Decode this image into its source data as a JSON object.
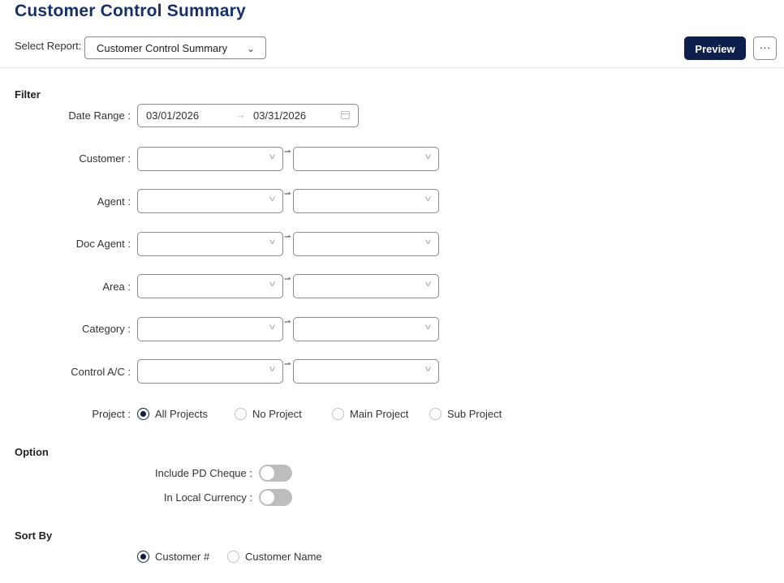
{
  "page": {
    "title": "Customer Control Summary"
  },
  "toolbar": {
    "select_report_label": "Select Report:",
    "selected_report": "Customer Control Summary",
    "preview_label": "Preview",
    "more_label": "···"
  },
  "filter": {
    "heading": "Filter",
    "date_range": {
      "label": "Date Range :",
      "from": "03/01/2026",
      "to": "03/31/2026"
    },
    "range_fields": [
      {
        "label": "Customer :",
        "from_value": "",
        "to_value": ""
      },
      {
        "label": "Agent :",
        "from_value": "",
        "to_value": ""
      },
      {
        "label": "Doc Agent :",
        "from_value": "",
        "to_value": ""
      },
      {
        "label": "Area :",
        "from_value": "",
        "to_value": ""
      },
      {
        "label": "Category :",
        "from_value": "",
        "to_value": ""
      },
      {
        "label": "Control A/C :",
        "from_value": "",
        "to_value": ""
      }
    ],
    "project": {
      "label": "Project :",
      "options": [
        "All Projects",
        "No Project",
        "Main Project",
        "Sub Project"
      ],
      "selected": "All Projects"
    }
  },
  "option": {
    "heading": "Option",
    "toggles": [
      {
        "label": "Include PD Cheque :",
        "on": false
      },
      {
        "label": "In Local Currency :",
        "on": false
      }
    ]
  },
  "sort_by": {
    "heading": "Sort By",
    "options": [
      "Customer #",
      "Customer Name"
    ],
    "selected": "Customer #"
  },
  "colors": {
    "brand_title": "#16306a",
    "primary_button": "#0d1f4d",
    "toggle_off": "#bdbdbd"
  },
  "icons": [
    "chevron-down-icon",
    "more-icon",
    "calendar-icon",
    "arrow-right-icon"
  ]
}
